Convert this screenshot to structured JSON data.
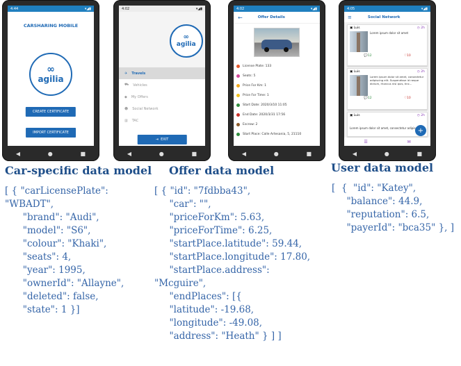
{
  "phones": {
    "carsharing": {
      "time": "4:44",
      "title": "CARSHARING MOBILE",
      "logo": "agilia",
      "create_button": "CREATE CERTIFICATE",
      "import_button": "IMPORT CERTIFICATE"
    },
    "menu": {
      "time": "4:02",
      "logo": "agilia",
      "items": [
        "Travels",
        "Vehicles",
        "My Offers",
        "Social Network",
        "TAC"
      ],
      "exit_button": "EXIT"
    },
    "offer": {
      "time": "4:02",
      "title": "Offer Details",
      "rows": [
        "License Plate: 133",
        "Seats: 5",
        "Price For Km: 1",
        "Price For Time: 1",
        "Start Date: 2020/3/10 11:05",
        "End Date: 2020/3/31 17:56",
        "Escrow: 2",
        "Start Place: Calle Artesania, 5, 21110"
      ]
    },
    "social": {
      "time": "4:05",
      "title": "Social Network",
      "posts": [
        {
          "user": "Luis",
          "time": "2h",
          "text": "Lorem ipsum dolor sit amet",
          "comments": "12",
          "likes": "10"
        },
        {
          "user": "Luis",
          "time": "2h",
          "text": "Lorem ipsum dolor sit amet, consectetur adipiscing elit. Suspendisse id neque dictum, rhoncus nisl quis, tinc...",
          "comments": "12",
          "likes": "10"
        },
        {
          "user": "Luis",
          "time": "2h",
          "text": "Lorem ipsum dolor sit amet, consectetur adipiscing elit.",
          "comments": "12",
          "likes": "10"
        }
      ],
      "fab": "+"
    }
  },
  "captions": {
    "car": "Car-specific data model",
    "offer": "Offer data model",
    "user": "User data model"
  },
  "code": {
    "car": "[ { \"carLicensePlate\":\n\"WBADT\",\n      \"brand\": \"Audi\",\n      \"model\": \"S6\",\n      \"colour\": \"Khaki\",\n      \"seats\": 4,\n      \"year\": 1995,\n      \"ownerId\": \"Allayne\",\n      \"deleted\": false,\n      \"state\": 1 }]",
    "offer": "[ { \"id\": \"7fdbba43\",\n     \"car\": \"\",\n     \"priceForKm\": 5.63,\n     \"priceForTime\": 6.25,\n     \"startPlace.latitude\": 59.44,\n     \"startPlace.longitude\": 17.80,\n     \"startPlace.address\":\n\"Mcguire\",\n     \"endPlaces\": [{\n     \"latitude\": -19.68,\n     \"longitude\": -49.08,\n     \"address\": \"Heath\" } ] ]",
    "user": "[  {  \"id\": \"Katey\",\n     \"balance\": 44.9,\n     \"reputation\": 6.5,\n     \"payerId\": \"bca35\" }, ]"
  },
  "colors": {
    "primary": "#1f6ab5",
    "statusbar": "#1f7fbf",
    "caption": "#1f4f8a",
    "code": "#3565a8"
  }
}
